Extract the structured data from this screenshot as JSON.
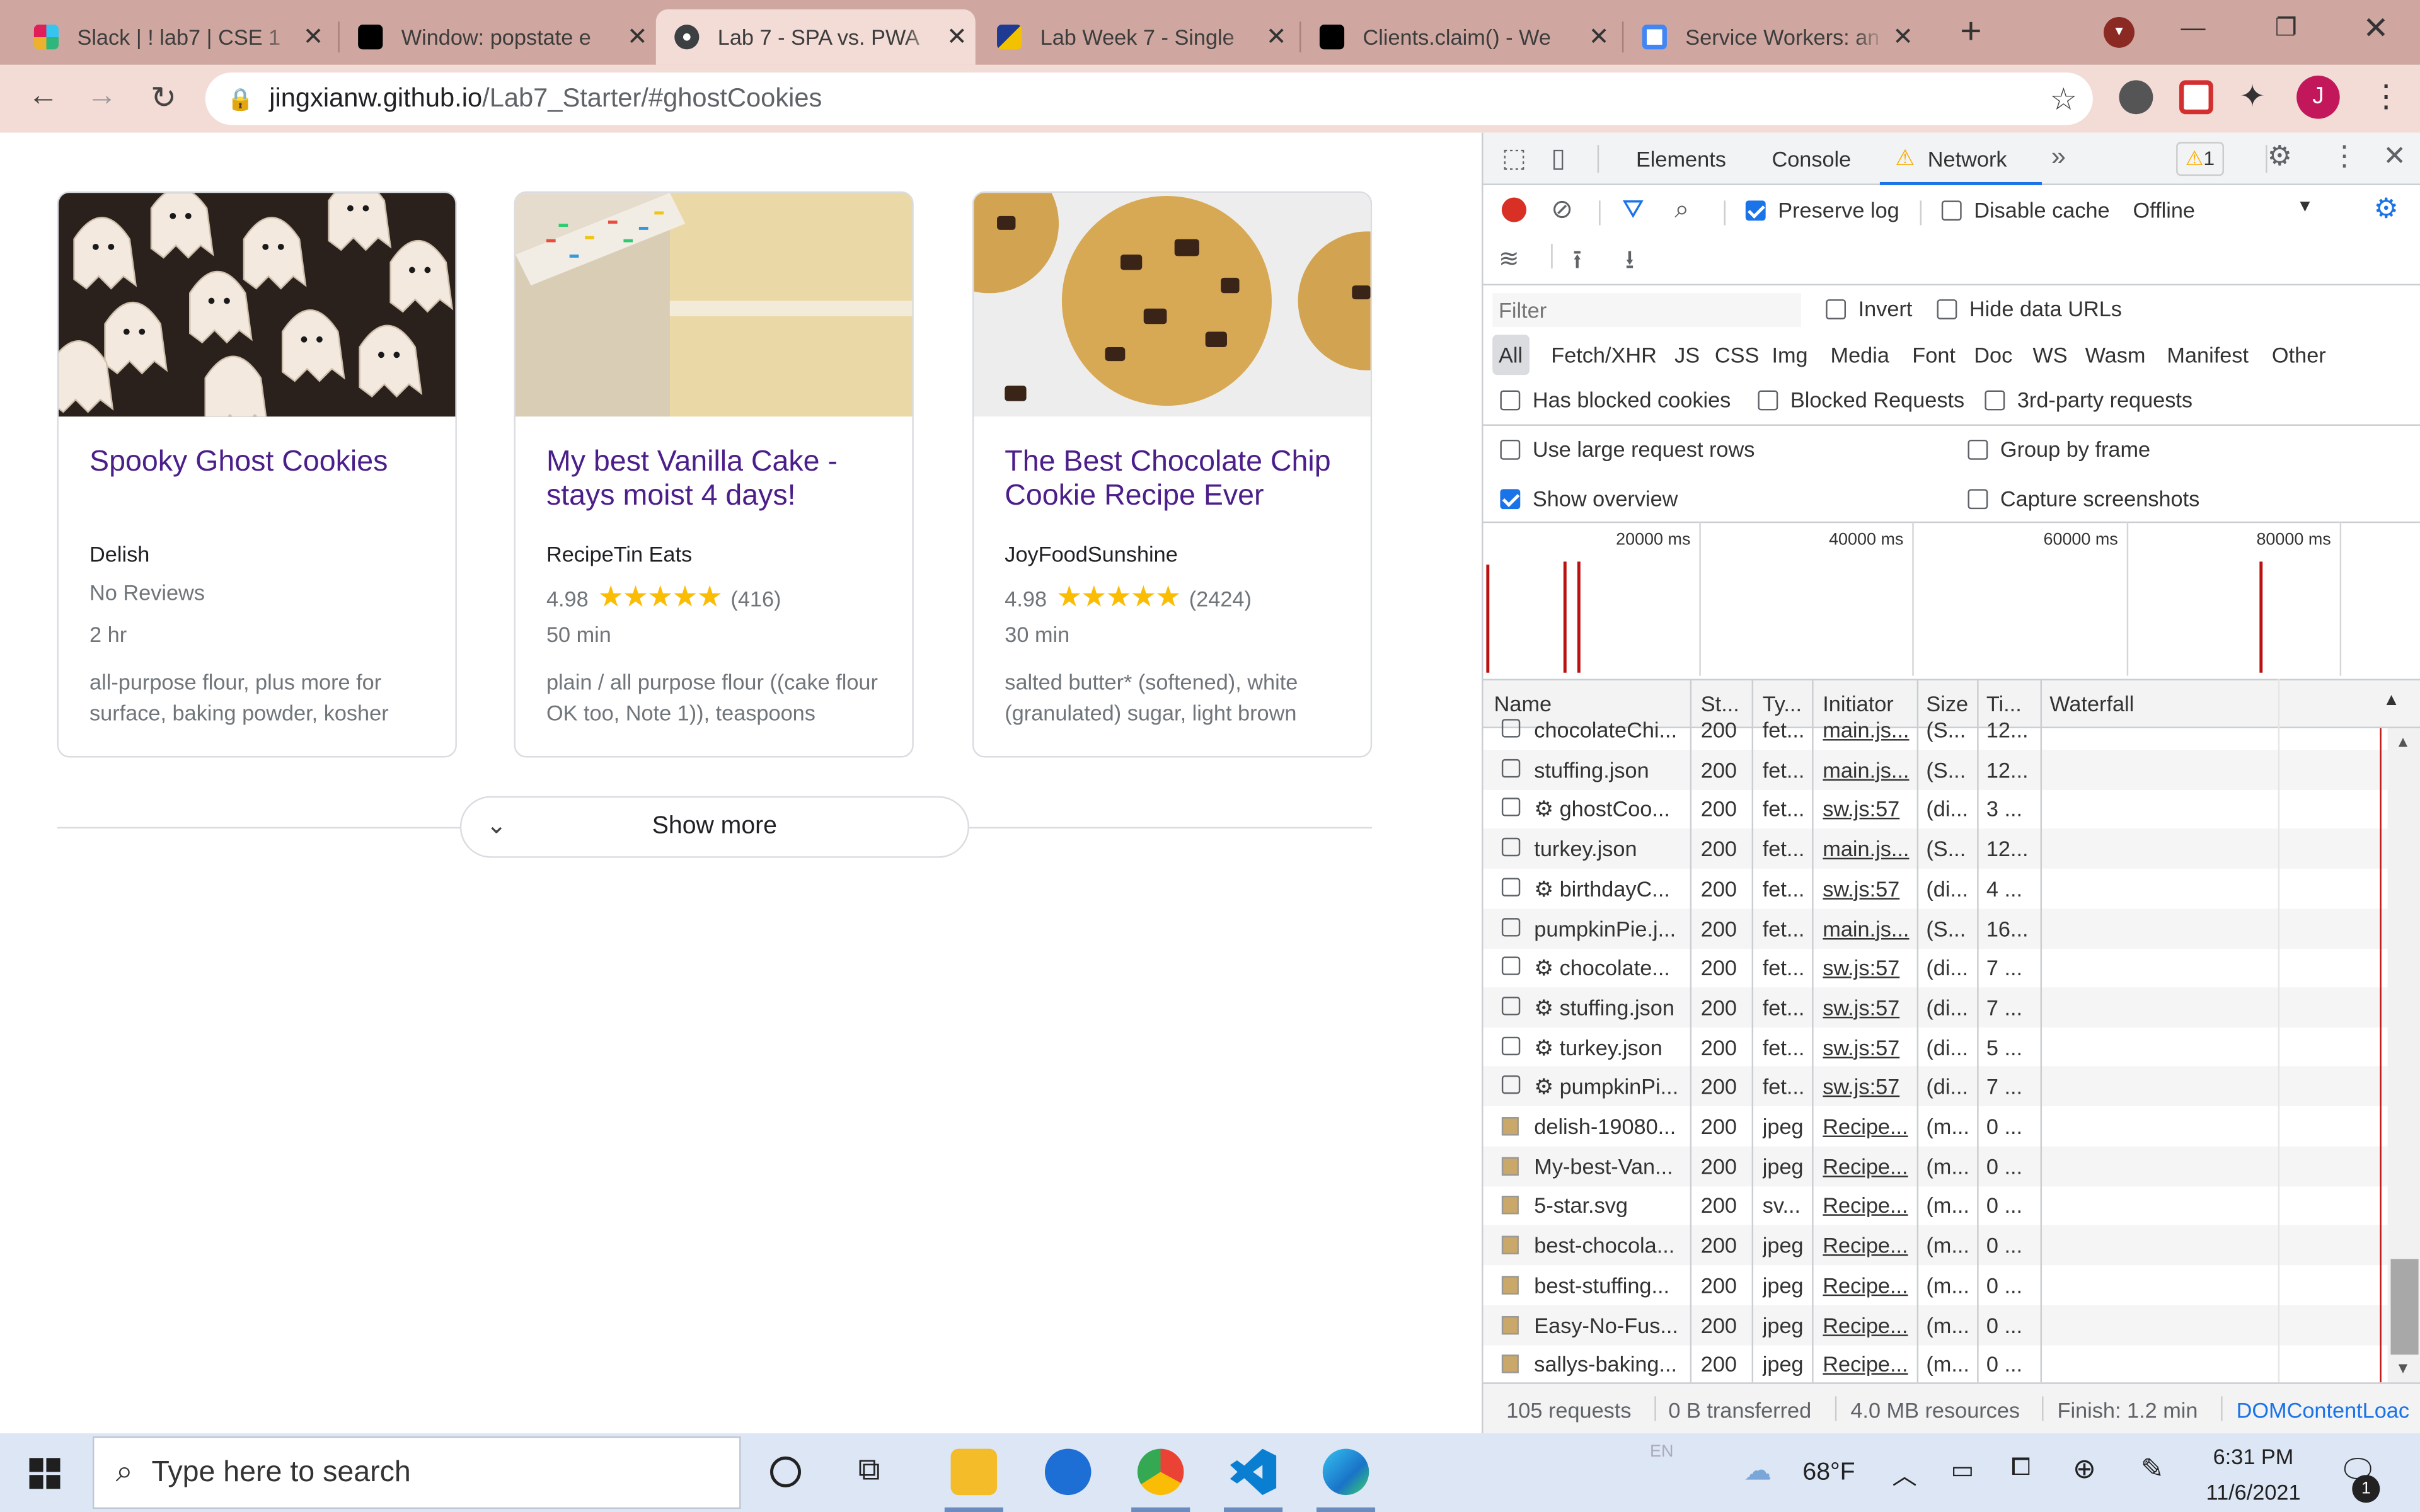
{
  "browser": {
    "tabs": [
      {
        "title": "Slack | ! lab7 | CSE 1",
        "favicon_color": "#e01e5a",
        "active": false
      },
      {
        "title": "Window: popstate e",
        "favicon_color": "#000000",
        "active": false
      },
      {
        "title": "Lab 7 - SPA vs. PWA",
        "favicon_color": "#3c4043",
        "active": true
      },
      {
        "title": "Lab Week 7 - Single",
        "favicon_color": "#1f3a93",
        "active": false
      },
      {
        "title": "Clients.claim() - We",
        "favicon_color": "#000000",
        "active": false
      },
      {
        "title": "Service Workers: an",
        "favicon_color": "#4285f4",
        "active": false
      }
    ],
    "new_tab_label": "+",
    "url_host": "jingxianw.github.io",
    "url_path": "/Lab7_Starter/#ghostCookies",
    "profile_initial": "J",
    "accent": "#c2185b"
  },
  "page": {
    "cards": [
      {
        "title": "Spooky Ghost Cookies",
        "source": "Delish",
        "rating_text": "No Reviews",
        "rating_value": "",
        "reviews": "",
        "stars": "",
        "time": "2 hr",
        "ingredients": "all-purpose flour, plus more for surface, baking powder, kosher"
      },
      {
        "title": "My best Vanilla Cake - stays moist 4 days!",
        "source": "RecipeTin Eats",
        "rating_text": "",
        "rating_value": "4.98",
        "reviews": "(416)",
        "stars": "★★★★★",
        "time": "50 min",
        "ingredients": "plain / all purpose flour ((cake flour OK too, Note 1)), teaspoons"
      },
      {
        "title": "The Best Chocolate Chip Cookie Recipe Ever",
        "source": "JoyFoodSunshine",
        "rating_text": "",
        "rating_value": "4.98",
        "reviews": "(2424)",
        "stars": "★★★★★",
        "time": "30 min",
        "ingredients": "salted butter* (softened), white (granulated) sugar, light brown"
      }
    ],
    "show_more_label": "Show more"
  },
  "devtools": {
    "tabs": [
      "Elements",
      "Console",
      "Network"
    ],
    "active_tab": "Network",
    "warning_count": "1",
    "preserve_log": "Preserve log",
    "disable_cache": "Disable cache",
    "throttle": "Offline",
    "filter_placeholder": "Filter",
    "invert": "Invert",
    "hide_data_urls": "Hide data URLs",
    "type_filters": [
      "All",
      "Fetch/XHR",
      "JS",
      "CSS",
      "Img",
      "Media",
      "Font",
      "Doc",
      "WS",
      "Wasm",
      "Manifest",
      "Other"
    ],
    "has_blocked_cookies": "Has blocked cookies",
    "blocked_requests": "Blocked Requests",
    "third_party": "3rd-party requests",
    "large_rows": "Use large request rows",
    "group_by_frame": "Group by frame",
    "show_overview": "Show overview",
    "capture_screenshots": "Capture screenshots",
    "overview_ticks": [
      "20000 ms",
      "40000 ms",
      "60000 ms",
      "80000 ms"
    ],
    "columns": [
      "Name",
      "St...",
      "Ty...",
      "Initiator",
      "Size",
      "Ti...",
      "Waterfall"
    ],
    "rows": [
      {
        "name": "chocolateChi...",
        "status": "200",
        "type": "fet...",
        "initiator": "main.js...",
        "size": "(S...",
        "time": "12...",
        "icon": "checkbox"
      },
      {
        "name": "stuffing.json",
        "status": "200",
        "type": "fet...",
        "initiator": "main.js...",
        "size": "(S...",
        "time": "12...",
        "icon": "checkbox"
      },
      {
        "name": "⚙ ghostCoo...",
        "status": "200",
        "type": "fet...",
        "initiator": "sw.js:57",
        "size": "(di...",
        "time": "3 ...",
        "icon": "checkbox"
      },
      {
        "name": "turkey.json",
        "status": "200",
        "type": "fet...",
        "initiator": "main.js...",
        "size": "(S...",
        "time": "12...",
        "icon": "checkbox"
      },
      {
        "name": "⚙ birthdayC...",
        "status": "200",
        "type": "fet...",
        "initiator": "sw.js:57",
        "size": "(di...",
        "time": "4 ...",
        "icon": "checkbox"
      },
      {
        "name": "pumpkinPie.j...",
        "status": "200",
        "type": "fet...",
        "initiator": "main.js...",
        "size": "(S...",
        "time": "16...",
        "icon": "checkbox"
      },
      {
        "name": "⚙ chocolate...",
        "status": "200",
        "type": "fet...",
        "initiator": "sw.js:57",
        "size": "(di...",
        "time": "7 ...",
        "icon": "checkbox"
      },
      {
        "name": "⚙ stuffing.json",
        "status": "200",
        "type": "fet...",
        "initiator": "sw.js:57",
        "size": "(di...",
        "time": "7 ...",
        "icon": "checkbox"
      },
      {
        "name": "⚙ turkey.json",
        "status": "200",
        "type": "fet...",
        "initiator": "sw.js:57",
        "size": "(di...",
        "time": "5 ...",
        "icon": "checkbox"
      },
      {
        "name": "⚙ pumpkinPi...",
        "status": "200",
        "type": "fet...",
        "initiator": "sw.js:57",
        "size": "(di...",
        "time": "7 ...",
        "icon": "checkbox"
      },
      {
        "name": "delish-19080...",
        "status": "200",
        "type": "jpeg",
        "initiator": "Recipe...",
        "size": "(m...",
        "time": "0 ...",
        "icon": "image"
      },
      {
        "name": "My-best-Van...",
        "status": "200",
        "type": "jpeg",
        "initiator": "Recipe...",
        "size": "(m...",
        "time": "0 ...",
        "icon": "image"
      },
      {
        "name": "5-star.svg",
        "status": "200",
        "type": "sv...",
        "initiator": "Recipe...",
        "size": "(m...",
        "time": "0 ...",
        "icon": "image"
      },
      {
        "name": "best-chocola...",
        "status": "200",
        "type": "jpeg",
        "initiator": "Recipe...",
        "size": "(m...",
        "time": "0 ...",
        "icon": "image"
      },
      {
        "name": "best-stuffing...",
        "status": "200",
        "type": "jpeg",
        "initiator": "Recipe...",
        "size": "(m...",
        "time": "0 ...",
        "icon": "image"
      },
      {
        "name": "Easy-No-Fus...",
        "status": "200",
        "type": "jpeg",
        "initiator": "Recipe...",
        "size": "(m...",
        "time": "0 ...",
        "icon": "image"
      },
      {
        "name": "sallys-baking...",
        "status": "200",
        "type": "jpeg",
        "initiator": "Recipe...",
        "size": "(m...",
        "time": "0 ...",
        "icon": "image"
      }
    ],
    "status_requests": "105 requests",
    "status_transferred": "0 B transferred",
    "status_resources": "4.0 MB resources",
    "status_finish": "Finish: 1.2 min",
    "status_dcl": "DOMContentLoac"
  },
  "taskbar": {
    "search_placeholder": "Type here to search",
    "weather": "68°F",
    "time": "6:31 PM",
    "date": "11/6/2021",
    "lang": "EN",
    "notification_count": "1"
  }
}
